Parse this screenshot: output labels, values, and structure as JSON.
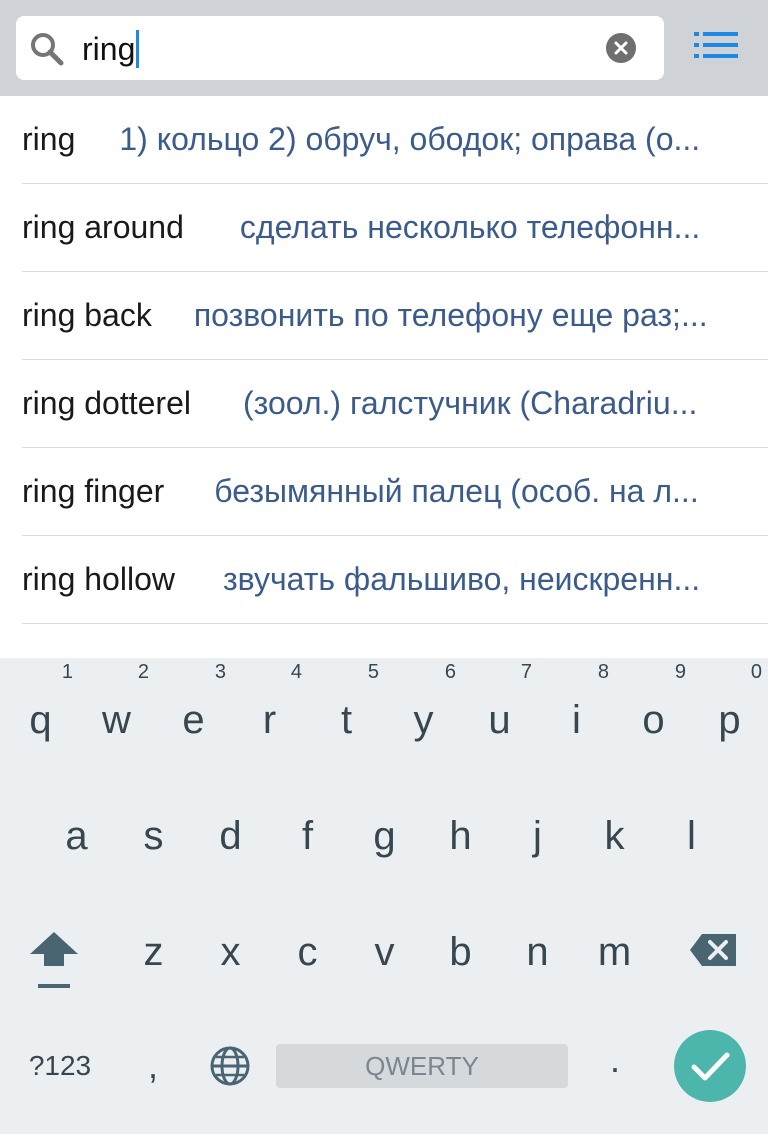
{
  "search": {
    "value": "ring",
    "icon": "search-icon",
    "clear_icon": "clear-icon",
    "menu_icon": "list-menu-icon"
  },
  "results": [
    {
      "term": "ring",
      "translation": "1) кольцо  2) обруч, ободок; оправа (о..."
    },
    {
      "term": "ring around",
      "translation": "сделать несколько телефонн..."
    },
    {
      "term": "ring back",
      "translation": "позвонить по телефону еще раз;..."
    },
    {
      "term": "ring dotterel",
      "translation": "(зоол.) галстучник (Charadriu..."
    },
    {
      "term": "ring finger",
      "translation": "безымянный палец (особ. на л..."
    },
    {
      "term": "ring hollow",
      "translation": "звучать фальшиво, неискренн..."
    }
  ],
  "keyboard": {
    "row1": [
      {
        "key": "q",
        "hint": "1"
      },
      {
        "key": "w",
        "hint": "2"
      },
      {
        "key": "e",
        "hint": "3"
      },
      {
        "key": "r",
        "hint": "4"
      },
      {
        "key": "t",
        "hint": "5"
      },
      {
        "key": "y",
        "hint": "6"
      },
      {
        "key": "u",
        "hint": "7"
      },
      {
        "key": "i",
        "hint": "8"
      },
      {
        "key": "o",
        "hint": "9"
      },
      {
        "key": "p",
        "hint": "0"
      }
    ],
    "row2": [
      "a",
      "s",
      "d",
      "f",
      "g",
      "h",
      "j",
      "k",
      "l"
    ],
    "row3": [
      "z",
      "x",
      "c",
      "v",
      "b",
      "n",
      "m"
    ],
    "symbols_label": "?123",
    "comma_label": ",",
    "space_label": "QWERTY",
    "period_label": ".",
    "accent_color": "#4db6ac"
  },
  "colors": {
    "topbar_bg": "#cfd3d8",
    "translation_text": "#3b5b8c",
    "menu_icon": "#1e88e5",
    "keyboard_bg": "#eceff1"
  }
}
